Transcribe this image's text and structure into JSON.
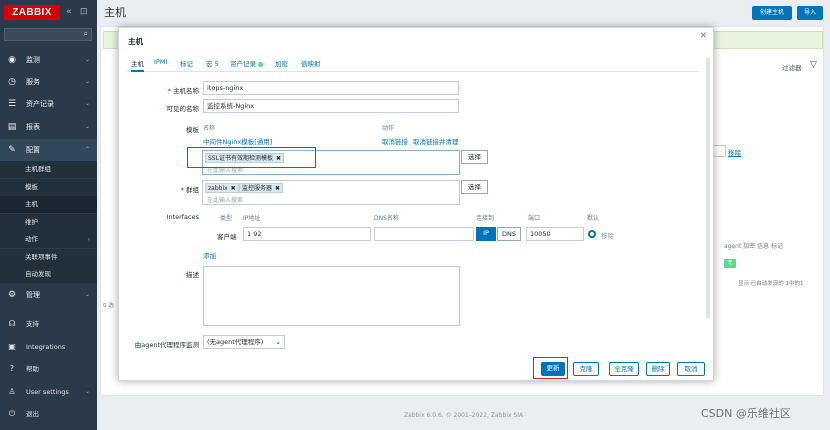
{
  "app": {
    "logo": "ZABBIX",
    "page_title": "主机"
  },
  "sidebar": {
    "search_placeholder": "",
    "items": [
      {
        "label": "监测",
        "icon": "eye-icon"
      },
      {
        "label": "服务",
        "icon": "clock-icon"
      },
      {
        "label": "资产记录",
        "icon": "list-icon"
      },
      {
        "label": "报表",
        "icon": "chart-icon"
      },
      {
        "label": "配置",
        "icon": "wrench-icon"
      }
    ],
    "sub_items": [
      "主机群组",
      "模板",
      "主机",
      "维护",
      "动作",
      "关联项事件",
      "自动发现"
    ],
    "lower_items": [
      {
        "label": "管理",
        "icon": "gear-icon"
      },
      {
        "label": "支持",
        "icon": "headset-icon"
      },
      {
        "label": "Integrations",
        "icon": "integrations-icon"
      },
      {
        "label": "帮助",
        "icon": "help-icon"
      },
      {
        "label": "User settings",
        "icon": "user-icon"
      },
      {
        "label": "退出",
        "icon": "power-icon"
      }
    ]
  },
  "header_buttons": {
    "create_host": "创建主机",
    "import": "导入"
  },
  "background": {
    "filter_tab": "过滤器",
    "unlink": "移除",
    "table_head": "agent 加密   信息   标记",
    "status_badge": "无",
    "shown": "显示 已自动发现的 1中的1",
    "small": "0 选"
  },
  "modal": {
    "title": "主机",
    "tabs": [
      "主机",
      "IPMI",
      "标记",
      "宏 5",
      "资产记录",
      "加密",
      "值映射"
    ],
    "host_name_label": "主机名称",
    "host_name_value": "itops-nginx",
    "visible_name_label": "可见的名称",
    "visible_name_value": "监控系统-Nginx",
    "templates_label": "模板",
    "col_name": "名称",
    "col_action": "动作",
    "linked_template": "中间件Nginx模板[通用]",
    "action_unlink": "取消链接",
    "action_unlink_clear": "取消链接并清理",
    "new_template_chip": "SSL证书有效期检测模板",
    "search_placeholder": "在此输入搜索",
    "select_button": "选择",
    "groups_label": "群组",
    "group_chips": [
      "zabbix",
      "监控服务器"
    ],
    "interfaces_label": "Interfaces",
    "if_cols": {
      "type": "类型",
      "ip": "IP地址",
      "dns": "DNS名称",
      "connect": "连接到",
      "port": "端口",
      "default": "默认"
    },
    "if_type": "客户端",
    "if_ip": "1         92",
    "if_port": "10050",
    "ip_btn": "IP",
    "dns_btn": "DNS",
    "remove_link": "移除",
    "add_link": "添加",
    "description_label": "描述",
    "proxy_label": "由agent代理程序监测",
    "proxy_value": "(无agent代理程序)",
    "buttons": {
      "update": "更新",
      "clone": "克隆",
      "full_clone": "全克隆",
      "delete": "删除",
      "cancel": "取消"
    }
  },
  "footer": "Zabbix 6.0.6. © 2001–2022, Zabbix SIA",
  "watermark": "CSDN @乐维社区"
}
